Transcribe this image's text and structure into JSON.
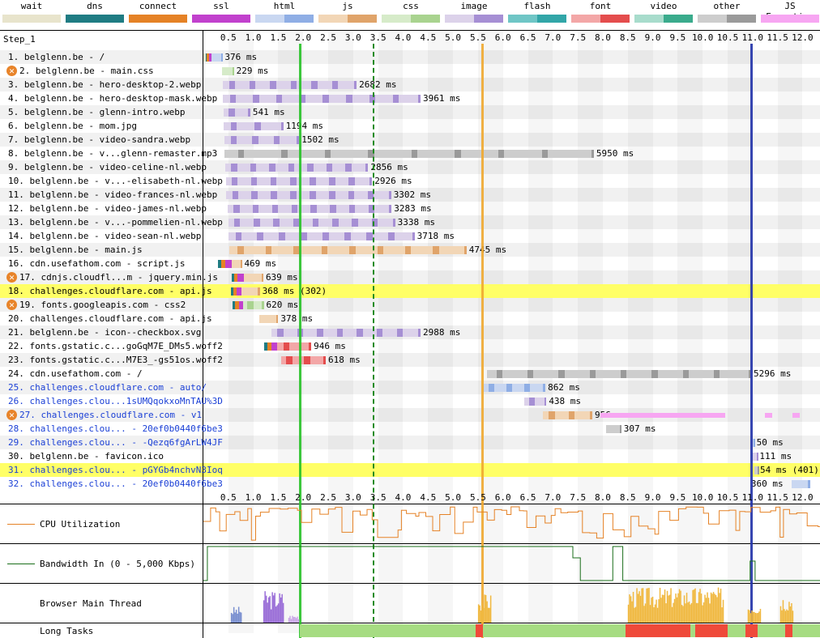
{
  "legend": [
    {
      "label": "wait",
      "color_light": "#e8e4cc",
      "color": "#e8e4cc"
    },
    {
      "label": "dns",
      "color_light": "#1f7c83",
      "color": "#1f7c83"
    },
    {
      "label": "connect",
      "color_light": "#e58226",
      "color": "#e58226"
    },
    {
      "label": "ssl",
      "color_light": "#c141cd",
      "color": "#c141cd"
    },
    {
      "label": "html",
      "color_light": "#c9d7f1",
      "color": "#8faee5"
    },
    {
      "label": "js",
      "color_light": "#f2d6b6",
      "color": "#e0a46a"
    },
    {
      "label": "css",
      "color_light": "#d6ebc9",
      "color": "#a9d38f"
    },
    {
      "label": "image",
      "color_light": "#dcd2ea",
      "color": "#a68fd4"
    },
    {
      "label": "flash",
      "color_light": "#6fc6c6",
      "color": "#32a6a8"
    },
    {
      "label": "font",
      "color_light": "#f3a7a7",
      "color": "#e44d4d"
    },
    {
      "label": "video",
      "color_light": "#a8dccc",
      "color": "#3aab8c"
    },
    {
      "label": "other",
      "color_light": "#cdcdcd",
      "color": "#9a9a9a"
    },
    {
      "label": "JS Execution",
      "color_light": "#f7a6f2",
      "color": "#f7a6f2"
    }
  ],
  "step_label": "Step_1",
  "axis_ticks": [
    "0.5",
    "1.0",
    "1.5",
    "2.0",
    "2.5",
    "3.0",
    "3.5",
    "4.0",
    "4.5",
    "5.0",
    "5.5",
    "6.0",
    "6.5",
    "7.0",
    "7.5",
    "8.0",
    "8.5",
    "9.0",
    "9.5",
    "10.0",
    "10.5",
    "11.0",
    "11.5",
    "12.0"
  ],
  "axis_max_s": 12.35,
  "markers": [
    {
      "name": "start-render",
      "t": 1.93,
      "color": "#28c228",
      "style": "solid"
    },
    {
      "name": "dom-interactive",
      "t": 3.41,
      "color": "#228b22",
      "style": "dashed"
    },
    {
      "name": "dom-content-loaded",
      "t": 5.58,
      "color": "#f0a830",
      "style": "solid"
    },
    {
      "name": "on-load",
      "t": 10.97,
      "color": "#2233aa",
      "style": "solid"
    }
  ],
  "requests": [
    {
      "label": "1. belglenn.be - /",
      "duration": "376 ms",
      "highlight": false,
      "blue": false,
      "error": false,
      "type": "html",
      "start": 0.0,
      "wait": 0.05,
      "dns": 0.02,
      "connect": 0.04,
      "ssl": 0.05,
      "end": 0.38
    },
    {
      "label": "2. belglenn.be - main.css",
      "duration": "229 ms",
      "highlight": false,
      "blue": false,
      "error": true,
      "type": "css",
      "start": 0.38,
      "end": 0.61
    },
    {
      "label": "3. belglenn.be - hero-desktop-2.webp",
      "duration": "2682 ms",
      "highlight": false,
      "blue": false,
      "error": false,
      "type": "image",
      "start": 0.39,
      "end": 3.07
    },
    {
      "label": "4. belglenn.be - hero-desktop-mask.webp",
      "duration": "3961 ms",
      "highlight": false,
      "blue": false,
      "error": false,
      "type": "image",
      "start": 0.39,
      "end": 4.35
    },
    {
      "label": "5. belglenn.be - glenn-intro.webp",
      "duration": "541 ms",
      "highlight": false,
      "blue": false,
      "error": false,
      "type": "image",
      "start": 0.4,
      "end": 0.94
    },
    {
      "label": "6. belglenn.be - mom.jpg",
      "duration": "1194 ms",
      "highlight": false,
      "blue": false,
      "error": false,
      "type": "image",
      "start": 0.41,
      "end": 1.6
    },
    {
      "label": "7. belglenn.be - video-sandra.webp",
      "duration": "1502 ms",
      "highlight": false,
      "blue": false,
      "error": false,
      "type": "image",
      "start": 0.42,
      "end": 1.92
    },
    {
      "label": "8. belglenn.be - v...glenn-remaster.mp3",
      "duration": "5950 ms",
      "highlight": false,
      "blue": false,
      "error": false,
      "type": "other",
      "start": 0.43,
      "end": 7.82
    },
    {
      "label": "9. belglenn.be - video-celine-nl.webp",
      "duration": "2856 ms",
      "highlight": false,
      "blue": false,
      "error": false,
      "type": "image",
      "start": 0.44,
      "end": 3.3
    },
    {
      "label": "10. belglenn.be - v...-elisabeth-nl.webp",
      "duration": "2926 ms",
      "highlight": false,
      "blue": false,
      "error": false,
      "type": "image",
      "start": 0.45,
      "end": 3.38
    },
    {
      "label": "11. belglenn.be - video-frances-nl.webp",
      "duration": "3302 ms",
      "highlight": false,
      "blue": false,
      "error": false,
      "type": "image",
      "start": 0.46,
      "end": 3.76
    },
    {
      "label": "12. belglenn.be - video-james-nl.webp",
      "duration": "3283 ms",
      "highlight": false,
      "blue": false,
      "error": false,
      "type": "image",
      "start": 0.49,
      "end": 3.77
    },
    {
      "label": "13. belglenn.be - v...-pommelien-nl.webp",
      "duration": "3338 ms",
      "highlight": false,
      "blue": false,
      "error": false,
      "type": "image",
      "start": 0.5,
      "end": 3.84
    },
    {
      "label": "14. belglenn.be - video-sean-nl.webp",
      "duration": "3718 ms",
      "highlight": false,
      "blue": false,
      "error": false,
      "type": "image",
      "start": 0.51,
      "end": 4.23
    },
    {
      "label": "15. belglenn.be - main.js",
      "duration": "4745 ms",
      "highlight": false,
      "blue": false,
      "error": false,
      "type": "js",
      "start": 0.52,
      "end": 5.27
    },
    {
      "label": "16. cdn.usefathom.com - script.js",
      "duration": "469 ms",
      "highlight": false,
      "blue": false,
      "error": false,
      "type": "js",
      "start": 0.3,
      "wait": 0.0,
      "dns": 0.05,
      "connect": 0.09,
      "ssl": 0.12,
      "end": 0.77
    },
    {
      "label": "17. cdnjs.cloudfl...m - jquery.min.js",
      "duration": "639 ms",
      "highlight": false,
      "blue": false,
      "error": true,
      "type": "js",
      "start": 0.56,
      "dns": 0.05,
      "connect": 0.07,
      "ssl": 0.13,
      "end": 1.2
    },
    {
      "label": "18. challenges.cloudflare.com - api.js",
      "duration": "368 ms (302)",
      "highlight": true,
      "blue": false,
      "error": false,
      "type": "js",
      "start": 0.55,
      "dns": 0.05,
      "connect": 0.07,
      "ssl": 0.1,
      "end": 1.13
    },
    {
      "label": "19. fonts.googleapis.com - css2",
      "duration": "620 ms",
      "highlight": false,
      "blue": false,
      "error": true,
      "type": "css",
      "start": 0.59,
      "dns": 0.05,
      "connect": 0.07,
      "ssl": 0.09,
      "end": 1.21
    },
    {
      "label": "20. challenges.cloudflare.com - api.js",
      "duration": "378 ms",
      "highlight": false,
      "blue": false,
      "error": false,
      "type": "js",
      "start": 1.12,
      "end": 1.5
    },
    {
      "label": "21. belglenn.be - icon--checkbox.svg",
      "duration": "2988 ms",
      "highlight": false,
      "blue": false,
      "error": false,
      "type": "image",
      "start": 1.36,
      "end": 4.35
    },
    {
      "label": "22. fonts.gstatic.c...goGqM7E_DMs5.woff2",
      "duration": "946 ms",
      "highlight": false,
      "blue": false,
      "error": false,
      "type": "font",
      "start": 1.21,
      "dns": 0.07,
      "connect": 0.09,
      "ssl": 0.1,
      "end": 2.16
    },
    {
      "label": "23. fonts.gstatic.c...M7E3_-gs51os.woff2",
      "duration": "618 ms",
      "highlight": false,
      "blue": false,
      "error": false,
      "type": "font",
      "start": 1.55,
      "end": 2.45
    },
    {
      "label": "24. cdn.usefathom.com - /",
      "duration": "5296 ms",
      "highlight": false,
      "blue": false,
      "error": false,
      "type": "other",
      "start": 5.68,
      "end": 10.97
    },
    {
      "label": "25. challenges.cloudflare.com - auto/",
      "duration": "862 ms",
      "highlight": false,
      "blue": true,
      "error": false,
      "type": "html",
      "start": 5.6,
      "end": 6.85
    },
    {
      "label": "26. challenges.clou...1sUMQqokxoMnTAU%3D",
      "duration": "438 ms",
      "highlight": false,
      "blue": true,
      "error": false,
      "type": "image",
      "start": 6.43,
      "end": 6.87
    },
    {
      "label": "27. challenges.cloudflare.com - v1",
      "duration": "956 ms",
      "highlight": false,
      "blue": true,
      "error": true,
      "type": "js",
      "start": 6.8,
      "end": 7.79
    },
    {
      "label": "28. challenges.clou... - 20ef0b0440f6be3",
      "duration": "307 ms",
      "highlight": false,
      "blue": true,
      "error": false,
      "type": "other",
      "start": 8.06,
      "end": 8.37
    },
    {
      "label": "29. challenges.clou... - -Qezq6fgArLW4JF",
      "duration": "50 ms",
      "highlight": false,
      "blue": true,
      "error": false,
      "type": "html",
      "start": 10.98,
      "end": 11.03
    },
    {
      "label": "30. belglenn.be - favicon.ico",
      "duration": "111 ms",
      "highlight": false,
      "blue": false,
      "error": false,
      "type": "image",
      "start": 10.98,
      "end": 11.09
    },
    {
      "label": "31. challenges.clou... - pGYGb4nchvN3Ioq",
      "duration": "54 ms (401)",
      "highlight": true,
      "blue": true,
      "error": false,
      "type": "other",
      "start": 11.04,
      "end": 11.1
    },
    {
      "label": "32. challenges.clou... - 20ef0b0440f6be3",
      "duration": "360 ms",
      "highlight": false,
      "blue": true,
      "error": false,
      "type": "html",
      "start": 11.78,
      "end": 12.15
    }
  ],
  "metrics": {
    "cpu_label": "CPU Utilization",
    "bandwidth_label": "Bandwidth In (0 - 5,000 Kbps)",
    "main_thread_label": "Browser Main Thread",
    "long_tasks_label": "Long Tasks"
  },
  "long_tasks": [
    {
      "start": 1.93,
      "end": 5.45,
      "kind": "ok"
    },
    {
      "start": 5.45,
      "end": 5.6,
      "kind": "long"
    },
    {
      "start": 5.6,
      "end": 8.45,
      "kind": "ok"
    },
    {
      "start": 8.45,
      "end": 9.75,
      "kind": "long"
    },
    {
      "start": 9.75,
      "end": 9.85,
      "kind": "ok"
    },
    {
      "start": 9.85,
      "end": 10.5,
      "kind": "long"
    },
    {
      "start": 10.5,
      "end": 10.85,
      "kind": "ok"
    },
    {
      "start": 10.85,
      "end": 11.1,
      "kind": "long"
    },
    {
      "start": 11.1,
      "end": 11.65,
      "kind": "ok"
    },
    {
      "start": 11.65,
      "end": 11.8,
      "kind": "long"
    },
    {
      "start": 11.8,
      "end": 12.35,
      "kind": "ok"
    }
  ]
}
